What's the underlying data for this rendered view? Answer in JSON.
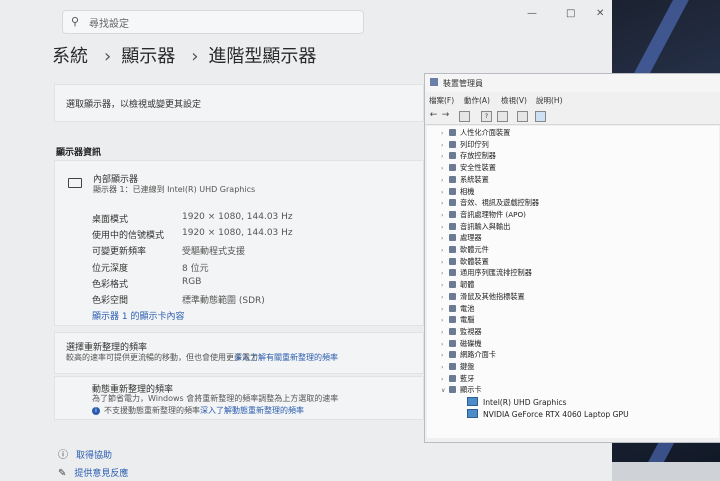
{
  "settings": {
    "search_placeholder": "尋找設定",
    "breadcrumb": [
      "系統",
      "顯示器",
      "進階型顯示器"
    ],
    "select_display_label": "選取顯示器，以檢視或變更其設定",
    "display_info_heading": "顯示器資訊",
    "internal_display_name": "內部顯示器",
    "internal_display_sub": "顯示器 1：已連線到 Intel(R) UHD Graphics",
    "info_rows": [
      {
        "label": "桌面模式",
        "value": "1920 × 1080, 144.03 Hz"
      },
      {
        "label": "使用中的信號模式",
        "value": "1920 × 1080, 144.03 Hz"
      },
      {
        "label": "可變更新頻率",
        "value": "受驅動程式支援"
      },
      {
        "label": "位元深度",
        "value": "8 位元"
      },
      {
        "label": "色彩格式",
        "value": "RGB"
      },
      {
        "label": "色彩空間",
        "value": "標準動態範圍 (SDR)"
      }
    ],
    "adapter_link": "顯示器 1 的顯示卡內容",
    "refresh_title": "選擇重新整理的頻率",
    "refresh_desc": "較高的速率可提供更流暢的移動，但也會使用更多電力",
    "refresh_link": "深入了解有關重新整理的頻率",
    "dynamic_title": "動態重新整理的頻率",
    "dynamic_desc": "為了節省電力，Windows 會將重新整理的頻率調整為上方選取的速率",
    "dynamic_note": "不支援動態重新整理的頻率",
    "dynamic_link": "深入了解動態重新整理的頻率",
    "help_link": "取得協助",
    "feedback_link": "提供意見反應"
  },
  "device_manager": {
    "title": "裝置管理員",
    "menu": [
      "檔案(F)",
      "動作(A)",
      "檢視(V)",
      "說明(H)"
    ],
    "categories": [
      "人性化介面裝置",
      "列印佇列",
      "存放控制器",
      "安全性裝置",
      "系統裝置",
      "相機",
      "音效、視訊及遊戲控制器",
      "音訊處理物件 (APO)",
      "音訊輸入與輸出",
      "處理器",
      "軟體元件",
      "軟體裝置",
      "通用序列匯流排控制器",
      "韌體",
      "滑鼠及其他指標裝置",
      "電池",
      "電腦",
      "監視器",
      "磁碟機",
      "網路介面卡",
      "鍵盤",
      "藍牙",
      "顯示卡"
    ],
    "display_adapters": [
      "Intel(R) UHD Graphics",
      "NVIDIA GeForce RTX 4060 Laptop GPU"
    ]
  }
}
